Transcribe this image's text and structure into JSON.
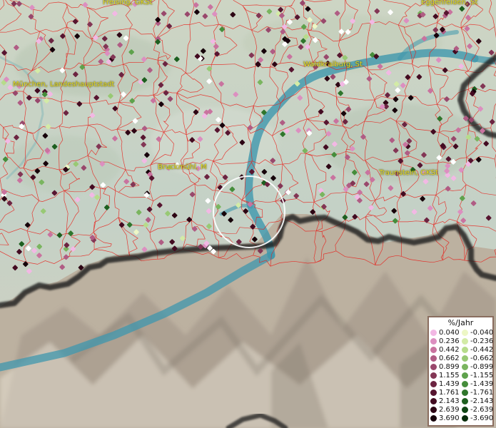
{
  "map": {
    "places": [
      {
        "name": "Freising, GKSt"
      },
      {
        "name": "Eggenfelden, St"
      },
      {
        "name": "München, Landeshauptstadt"
      },
      {
        "name": "Waldkraiburg, St"
      },
      {
        "name": "Bruckmühl, M"
      },
      {
        "name": "Traunstein, GKSt"
      }
    ],
    "colors": {
      "relief": "#c9d3c6",
      "alps": "#bdb2a0",
      "river": "#3f97ad",
      "borders": "#e8201a",
      "state_border": "#1a1a1a",
      "selection_ring": "#ffffff"
    },
    "legend": {
      "title": "%/Jahr",
      "positive": [
        {
          "value": "0.040",
          "color": "#f2b8e4"
        },
        {
          "value": "0.236",
          "color": "#dc8fc0"
        },
        {
          "value": "0.442",
          "color": "#c9739f"
        },
        {
          "value": "0.662",
          "color": "#b05c84"
        },
        {
          "value": "0.899",
          "color": "#99486c"
        },
        {
          "value": "1.155",
          "color": "#833655"
        },
        {
          "value": "1.439",
          "color": "#6c2441"
        },
        {
          "value": "1.761",
          "color": "#571530"
        },
        {
          "value": "2.143",
          "color": "#430b21"
        },
        {
          "value": "2.639",
          "color": "#2d0514"
        },
        {
          "value": "3.690",
          "color": "#16020a"
        }
      ],
      "negative": [
        {
          "value": "-0.040",
          "color": "#edf7c5"
        },
        {
          "value": "-0.236",
          "color": "#d3eba6"
        },
        {
          "value": "-0.442",
          "color": "#b6dc8a"
        },
        {
          "value": "-0.662",
          "color": "#98c974"
        },
        {
          "value": "-0.899",
          "color": "#7ab55f"
        },
        {
          "value": "-1.155",
          "color": "#5ea24c"
        },
        {
          "value": "-1.439",
          "color": "#458d3b"
        },
        {
          "value": "-1.761",
          "color": "#2f762c"
        },
        {
          "value": "-2.143",
          "color": "#1d5f1f"
        },
        {
          "value": "-2.639",
          "color": "#0f4614"
        },
        {
          "value": "-3.690",
          "color": "#062c0a"
        }
      ]
    }
  }
}
